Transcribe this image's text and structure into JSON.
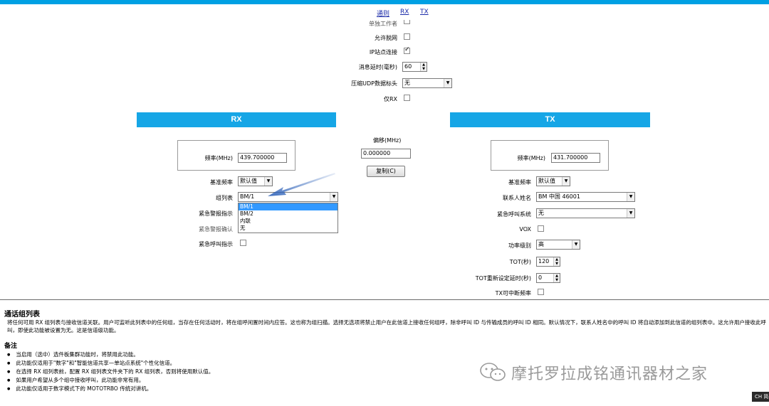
{
  "nav": {
    "general": "通则",
    "rx": "RX",
    "tx": "TX"
  },
  "top": {
    "standalone_label": "单独工作者",
    "allow_talkaround_label": "允许脱网",
    "ip_site_connect_label": "IP站点连接",
    "ip_site_connect_checked": true,
    "msg_timeout_label": "消息延时(毫秒)",
    "msg_timeout_value": "60",
    "compress_udp_label": "压缩UDP数据标头",
    "compress_udp_value": "无",
    "rx_only_label": "仅RX"
  },
  "rx": {
    "header": "RX",
    "freq_label": "频率(MHz)",
    "freq_value": "439.700000",
    "ref_freq_label": "基准频率",
    "ref_freq_value": "默认值",
    "group_list_label": "组列表",
    "group_list_value": "BM/1",
    "group_list_options": [
      "BM/1",
      "BM/2",
      "内联",
      "无"
    ],
    "emergency_alarm_ind_label": "紧急警报指示",
    "emergency_alarm_ack_label": "紧急警报确认",
    "emergency_call_ind_label": "紧急呼叫指示"
  },
  "offset": {
    "label": "偏移(MHz)",
    "value": "0.000000",
    "copy_button": "复制(C)"
  },
  "tx": {
    "header": "TX",
    "freq_label": "频率(MHz)",
    "freq_value": "431.700000",
    "ref_freq_label": "基准频率",
    "ref_freq_value": "默认值",
    "contact_label": "联系人姓名",
    "contact_value": "BM 中国 46001",
    "emergency_system_label": "紧急呼叫系统",
    "emergency_system_value": "无",
    "vox_label": "VOX",
    "power_label": "功率级别",
    "power_value": "高",
    "tot_label": "TOT(秒)",
    "tot_value": "120",
    "tot_rekey_label": "TOT重新设定延时(秒)",
    "tot_rekey_value": "0",
    "tx_interrupt_label": "TX可中断频率"
  },
  "help": {
    "title": "通话组列表",
    "body": "将任何可用 RX 组列表与接收信道关联。用户可监听此列表中的任何组，当存在任何活动时，将在组呼闲置时间内应答。这也称为组扫描。选择无选项将禁止用户在此信道上接收任何组呼，除非呼叫 ID 与传输成员的呼叫 ID 相同。默认情况下，联系人姓名中的呼叫 ID 将自动添加到此信道的组列表中。这允许用户接收此呼叫，即使此功能被设置为无。这是信道级功能。",
    "notes_title": "备注",
    "notes": [
      "当启用（选中）选件板集群功能时，将禁用此功能。",
      "此功能仅适用于\"数字\"和\"智能信道共享—单站点系统\"个性化信道。",
      "在选择 RX 组列表前，配置 RX 组列表文件夹下的 RX 组列表，否则将使用默认值。",
      "如果用户希望从多个组中接收呼叫，此功能非常有用。",
      "此功能仅适用于数字模式下的 MOTOTRBO 传统对讲机。"
    ]
  },
  "watermark": "摩托罗拉成铭通讯器材之家",
  "corner_label": "CH 简"
}
